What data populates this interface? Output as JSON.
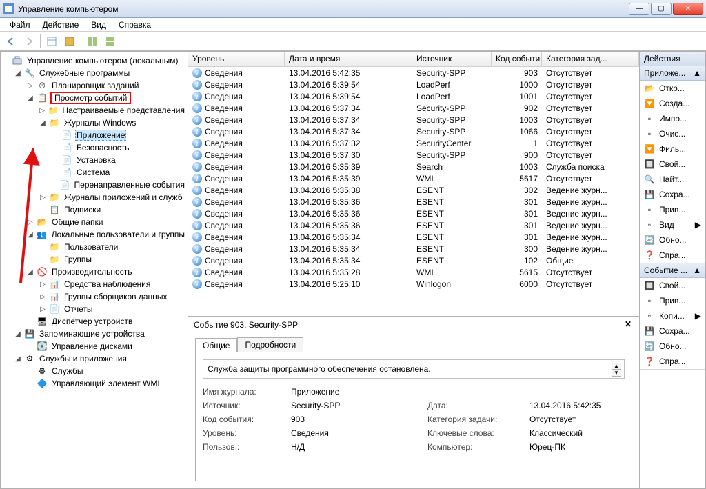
{
  "window": {
    "title": "Управление компьютером"
  },
  "menu": {
    "file": "Файл",
    "action": "Действие",
    "view": "Вид",
    "help": "Справка"
  },
  "tree": {
    "root": "Управление компьютером (локальным)",
    "util_progs": "Служебные программы",
    "task_sched": "Планировщик заданий",
    "event_viewer": "Просмотр событий",
    "custom_views": "Настраиваемые представления",
    "windows_logs": "Журналы Windows",
    "application": "Приложение",
    "security": "Безопасность",
    "setup": "Установка",
    "system": "Система",
    "forwarded": "Перенаправленные события",
    "app_svc_logs": "Журналы приложений и служб",
    "subscriptions": "Подписки",
    "shared_folders": "Общие папки",
    "local_users": "Локальные пользователи и группы",
    "users": "Пользователи",
    "groups": "Группы",
    "performance": "Производительность",
    "mon_tools": "Средства наблюдения",
    "dcs": "Группы сборщиков данных",
    "reports": "Отчеты",
    "dev_mgr": "Диспетчер устройств",
    "storage": "Запоминающие устройства",
    "disk_mgmt": "Управление дисками",
    "services_apps": "Службы и приложения",
    "services": "Службы",
    "wmi": "Управляющий элемент WMI"
  },
  "list": {
    "cols": {
      "level": "Уровень",
      "date": "Дата и время",
      "source": "Источник",
      "code": "Код события",
      "category": "Категория зад..."
    },
    "level_label": "Сведения",
    "rows": [
      {
        "d": "13.04.2016 5:42:35",
        "s": "Security-SPP",
        "c": 903,
        "cat": "Отсутствует"
      },
      {
        "d": "13.04.2016 5:39:54",
        "s": "LoadPerf",
        "c": 1000,
        "cat": "Отсутствует"
      },
      {
        "d": "13.04.2016 5:39:54",
        "s": "LoadPerf",
        "c": 1001,
        "cat": "Отсутствует"
      },
      {
        "d": "13.04.2016 5:37:34",
        "s": "Security-SPP",
        "c": 902,
        "cat": "Отсутствует"
      },
      {
        "d": "13.04.2016 5:37:34",
        "s": "Security-SPP",
        "c": 1003,
        "cat": "Отсутствует"
      },
      {
        "d": "13.04.2016 5:37:34",
        "s": "Security-SPP",
        "c": 1066,
        "cat": "Отсутствует"
      },
      {
        "d": "13.04.2016 5:37:32",
        "s": "SecurityCenter",
        "c": 1,
        "cat": "Отсутствует"
      },
      {
        "d": "13.04.2016 5:37:30",
        "s": "Security-SPP",
        "c": 900,
        "cat": "Отсутствует"
      },
      {
        "d": "13.04.2016 5:35:39",
        "s": "Search",
        "c": 1003,
        "cat": "Служба поиска"
      },
      {
        "d": "13.04.2016 5:35:39",
        "s": "WMI",
        "c": 5617,
        "cat": "Отсутствует"
      },
      {
        "d": "13.04.2016 5:35:38",
        "s": "ESENT",
        "c": 302,
        "cat": "Ведение журн..."
      },
      {
        "d": "13.04.2016 5:35:36",
        "s": "ESENT",
        "c": 301,
        "cat": "Ведение журн..."
      },
      {
        "d": "13.04.2016 5:35:36",
        "s": "ESENT",
        "c": 301,
        "cat": "Ведение журн..."
      },
      {
        "d": "13.04.2016 5:35:36",
        "s": "ESENT",
        "c": 301,
        "cat": "Ведение журн..."
      },
      {
        "d": "13.04.2016 5:35:34",
        "s": "ESENT",
        "c": 301,
        "cat": "Ведение журн..."
      },
      {
        "d": "13.04.2016 5:35:34",
        "s": "ESENT",
        "c": 300,
        "cat": "Ведение журн..."
      },
      {
        "d": "13.04.2016 5:35:34",
        "s": "ESENT",
        "c": 102,
        "cat": "Общие"
      },
      {
        "d": "13.04.2016 5:35:28",
        "s": "WMI",
        "c": 5615,
        "cat": "Отсутствует"
      },
      {
        "d": "13.04.2016 5:25:10",
        "s": "Winlogon",
        "c": 6000,
        "cat": "Отсутствует"
      }
    ]
  },
  "detail": {
    "title": "Событие 903, Security-SPP",
    "tabs": {
      "general": "Общие",
      "details": "Подробности"
    },
    "description": "Служба защиты программного обеспечения остановлена.",
    "labels": {
      "log_name": "Имя журнала:",
      "source": "Источник:",
      "event_id": "Код события:",
      "level": "Уровень:",
      "user": "Пользов.:",
      "date": "Дата:",
      "task_cat": "Категория задачи:",
      "keywords": "Ключевые слова:",
      "computer": "Компьютер:"
    },
    "values": {
      "log_name": "Приложение",
      "source": "Security-SPP",
      "event_id": "903",
      "level": "Сведения",
      "user": "Н/Д",
      "date": "13.04.2016 5:42:35",
      "task_cat": "Отсутствует",
      "keywords": "Классический",
      "computer": "Юрец-ПК"
    }
  },
  "actions": {
    "head": "Действия",
    "section1_title": "Приложе...",
    "items1": [
      "Откр...",
      "Созда...",
      "Импо...",
      "Очис...",
      "Филь...",
      "Свой...",
      "Найт...",
      "Сохра...",
      "Прив...",
      "Вид",
      "Обно...",
      "Спра..."
    ],
    "section2_title": "Событие ...",
    "items2": [
      "Свой...",
      "Прив...",
      "Копи...",
      "Сохра...",
      "Обно...",
      "Спра..."
    ]
  }
}
